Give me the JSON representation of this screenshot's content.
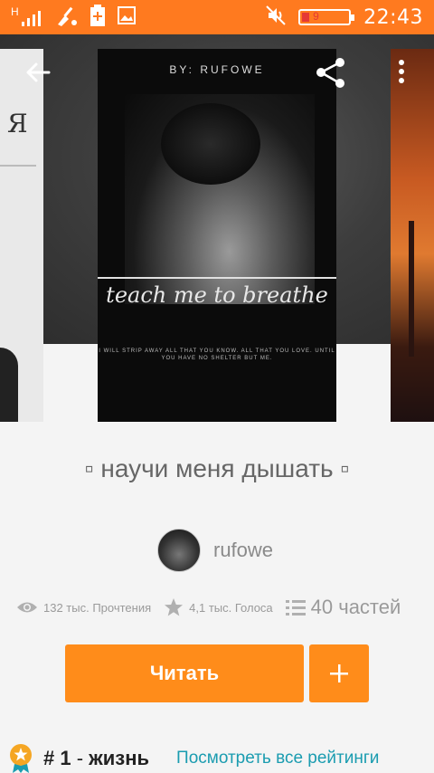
{
  "status_bar": {
    "carrier": "H",
    "battery_level": "9",
    "time": "22:43"
  },
  "cover": {
    "by_line": "BY: RUFOWE",
    "cover_title": "teach me to breathe",
    "quote": "I WILL STRIP AWAY ALL THAT YOU KNOW. ALL THAT YOU LOVE. UNTIL YOU HAVE NO SHELTER BUT ME.",
    "left_cover_letter": "Я"
  },
  "story": {
    "title": "▫ научи меня дышать ▫",
    "author": "rufowe"
  },
  "stats": {
    "reads": "132 тыс. Прочтения",
    "votes": "4,1 тыс. Голоса",
    "parts": "40 частей"
  },
  "actions": {
    "read_label": "Читать",
    "add_label": "+"
  },
  "ranking": {
    "rank": "# 1",
    "separator": "-",
    "category": "жизнь",
    "view_all": "Посмотреть все рейтинги"
  },
  "colors": {
    "status_bar": "#ff7a1f",
    "accent": "#ff8c1a",
    "link": "#1a9cb0"
  }
}
